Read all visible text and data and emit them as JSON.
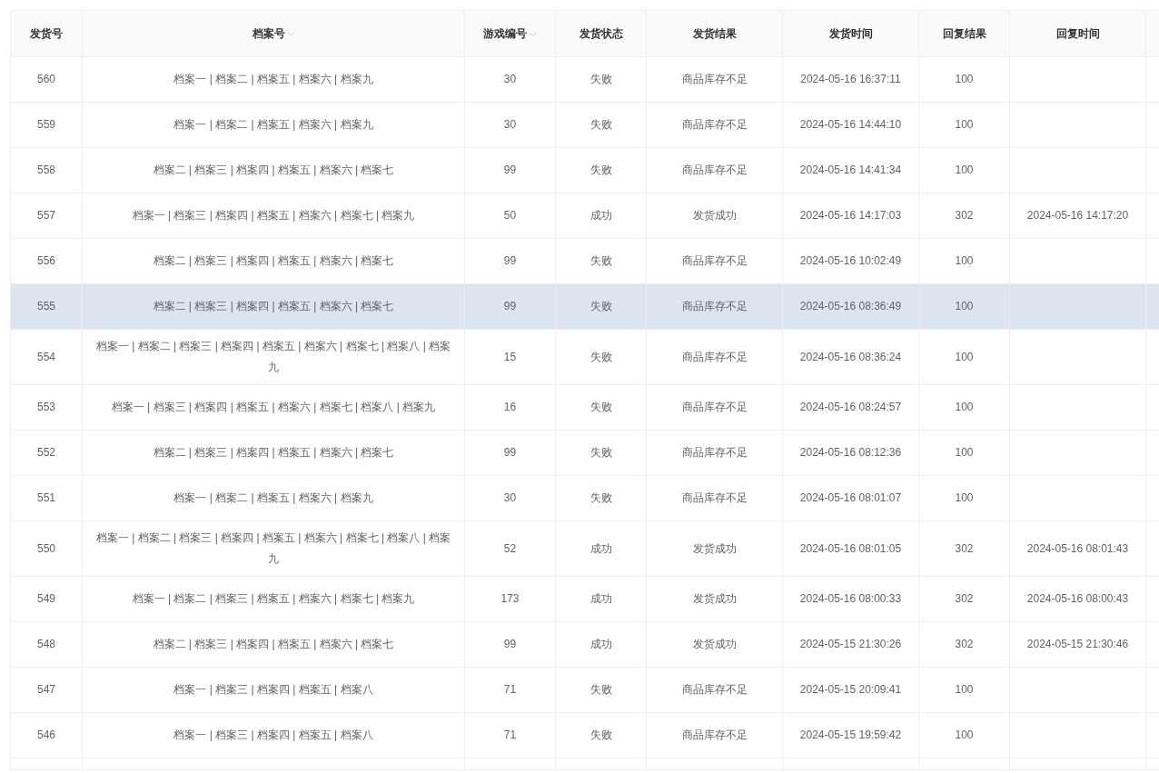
{
  "table": {
    "columns": [
      {
        "label": "发货号",
        "sortable": false
      },
      {
        "label": "档案号",
        "sortable": true
      },
      {
        "label": "游戏编号",
        "sortable": true
      },
      {
        "label": "发货状态",
        "sortable": false
      },
      {
        "label": "发货结果",
        "sortable": false
      },
      {
        "label": "发货时间",
        "sortable": false
      },
      {
        "label": "回复结果",
        "sortable": false
      },
      {
        "label": "回复时间",
        "sortable": false
      }
    ],
    "rows": [
      {
        "id": "560",
        "archives": "档案一 | 档案二 | 档案五 | 档案六 | 档案九",
        "game_no": "30",
        "status": "失败",
        "result": "商品库存不足",
        "sent_at": "2024-05-16 16:37:11",
        "reply": "100",
        "hovered": false
      },
      {
        "id": "559",
        "archives": "档案一 | 档案二 | 档案五 | 档案六 | 档案九",
        "game_no": "30",
        "status": "失败",
        "result": "商品库存不足",
        "sent_at": "2024-05-16 14:44:10",
        "reply": "100",
        "hovered": false
      },
      {
        "id": "558",
        "archives": "档案二 | 档案三 | 档案四 | 档案五 | 档案六 | 档案七",
        "game_no": "99",
        "status": "失败",
        "result": "商品库存不足",
        "sent_at": "2024-05-16 14:41:34",
        "reply": "100",
        "hovered": false
      },
      {
        "id": "557",
        "archives": "档案一 | 档案三 | 档案四 | 档案五 | 档案六 | 档案七 | 档案九",
        "game_no": "50",
        "status": "成功",
        "result": "发货成功",
        "sent_at": "2024-05-16 14:17:03",
        "reply": "302",
        "reply_at": "2024-05-16 14:17:20",
        "hovered": false
      },
      {
        "id": "556",
        "archives": "档案二 | 档案三 | 档案四 | 档案五 | 档案六 | 档案七",
        "game_no": "99",
        "status": "失败",
        "result": "商品库存不足",
        "sent_at": "2024-05-16 10:02:49",
        "reply": "100",
        "hovered": false
      },
      {
        "id": "555",
        "archives": "档案二 | 档案三 | 档案四 | 档案五 | 档案六 | 档案七",
        "game_no": "99",
        "status": "失败",
        "result": "商品库存不足",
        "sent_at": "2024-05-16 08:36:49",
        "reply": "100",
        "hovered": true
      },
      {
        "id": "554",
        "archives": "档案一 | 档案二 | 档案三 | 档案四 | 档案五 | 档案六 | 档案七 | 档案八 | 档案九",
        "game_no": "15",
        "status": "失败",
        "result": "商品库存不足",
        "sent_at": "2024-05-16 08:36:24",
        "reply": "100",
        "hovered": false
      },
      {
        "id": "553",
        "archives": "档案一 | 档案三 | 档案四 | 档案五 | 档案六 | 档案七 | 档案八 | 档案九",
        "game_no": "16",
        "status": "失败",
        "result": "商品库存不足",
        "sent_at": "2024-05-16 08:24:57",
        "reply": "100",
        "hovered": false
      },
      {
        "id": "552",
        "archives": "档案二 | 档案三 | 档案四 | 档案五 | 档案六 | 档案七",
        "game_no": "99",
        "status": "失败",
        "result": "商品库存不足",
        "sent_at": "2024-05-16 08:12:36",
        "reply": "100",
        "hovered": false
      },
      {
        "id": "551",
        "archives": "档案一 | 档案二 | 档案五 | 档案六 | 档案九",
        "game_no": "30",
        "status": "失败",
        "result": "商品库存不足",
        "sent_at": "2024-05-16 08:01:07",
        "reply": "100",
        "hovered": false
      },
      {
        "id": "550",
        "archives": "档案一 | 档案二 | 档案三 | 档案四 | 档案五 | 档案六 | 档案七 | 档案八 | 档案九",
        "game_no": "52",
        "status": "成功",
        "result": "发货成功",
        "sent_at": "2024-05-16 08:01:05",
        "reply": "302",
        "reply_at": "2024-05-16 08:01:43",
        "hovered": false
      },
      {
        "id": "549",
        "archives": "档案一 | 档案二 | 档案三 | 档案五 | 档案六 | 档案七 | 档案九",
        "game_no": "173",
        "status": "成功",
        "result": "发货成功",
        "sent_at": "2024-05-16 08:00:33",
        "reply": "302",
        "reply_at": "2024-05-16 08:00:43",
        "hovered": false
      },
      {
        "id": "548",
        "archives": "档案二 | 档案三 | 档案四 | 档案五 | 档案六 | 档案七",
        "game_no": "99",
        "status": "成功",
        "result": "发货成功",
        "sent_at": "2024-05-15 21:30:26",
        "reply": "302",
        "reply_at": "2024-05-15 21:30:46",
        "hovered": false
      },
      {
        "id": "547",
        "archives": "档案一 | 档案三 | 档案四 | 档案五 | 档案八",
        "game_no": "71",
        "status": "失败",
        "result": "商品库存不足",
        "sent_at": "2024-05-15 20:09:41",
        "reply": "100",
        "hovered": false
      },
      {
        "id": "546",
        "archives": "档案一 | 档案三 | 档案四 | 档案五 | 档案八",
        "game_no": "71",
        "status": "失败",
        "result": "商品库存不足",
        "sent_at": "2024-05-15 19:59:42",
        "reply": "100",
        "hovered": false
      }
    ]
  }
}
